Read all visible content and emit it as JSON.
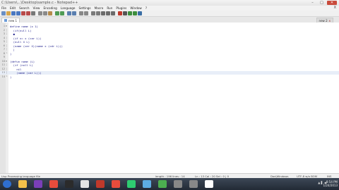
{
  "window": {
    "title": "C:\\Users\\...\\Desktop\\sample.c - Notepad++",
    "controls": {
      "minimize": "–",
      "maximize": "□",
      "close": "✕"
    }
  },
  "menu": {
    "items": [
      "File",
      "Edit",
      "Search",
      "View",
      "Encoding",
      "Language",
      "Settings",
      "Macro",
      "Run",
      "Plugins",
      "Window",
      "?"
    ],
    "close": "X"
  },
  "toolbar": {
    "icons": [
      "new-icon",
      "open-icon",
      "save-icon",
      "save-all-icon",
      "close-icon",
      "close-all-icon",
      "print-icon",
      "cut-icon",
      "copy-icon",
      "paste-icon",
      "undo-icon",
      "redo-icon",
      "find-icon",
      "replace-icon",
      "zoom-in-icon",
      "zoom-out-icon",
      "sync-v-icon",
      "sync-h-icon",
      "wrap-icon",
      "all-chars-icon",
      "indent-guide-icon",
      "macro-record-icon",
      "macro-stop-icon",
      "macro-play-icon",
      "macro-run-icon",
      "macro-save-icon"
    ],
    "colors": [
      "#6a8fc4",
      "#d7a64a",
      "#4a78c1",
      "#4a78c1",
      "#b84a4a",
      "#b84a4a",
      "#777777",
      "#8a8a8a",
      "#8a8a8a",
      "#b58a4a",
      "#4f9b54",
      "#4f9b54",
      "#5a7fb0",
      "#5a7fb0",
      "#888888",
      "#888888",
      "#7a7a7a",
      "#7a7a7a",
      "#6b6b6b",
      "#6b6b6b",
      "#6b6b6b",
      "#c0392b",
      "#555555",
      "#3d8e3d",
      "#3d8e3d",
      "#3a6ea5"
    ]
  },
  "tabs": [
    {
      "label": "new 1",
      "active": true
    },
    {
      "label": "new 2",
      "active": false
    }
  ],
  "editor": {
    "lines": [
      {
        "n": "1",
        "fold": "⊟",
        "code": "define name (x 1)"
      },
      {
        "n": "2",
        "fold": "│",
        "code": "  (if(null L)"
      },
      {
        "n": "3",
        "fold": "│",
        "code": "  ●"
      },
      {
        "n": "4",
        "fold": "│",
        "code": "  (if x= x (car L))"
      },
      {
        "n": "5",
        "fold": "│",
        "code": "  (null X L)"
      },
      {
        "n": "6",
        "fold": "│",
        "code": "  (name (cer X)(name x (cdr L)))"
      },
      {
        "n": "7",
        "fold": "│",
        "code": "  |"
      },
      {
        "n": "8",
        "fold": "└",
        "code": ")"
      },
      {
        "n": "9",
        "fold": "",
        "code": ""
      },
      {
        "n": "10",
        "fold": "⊟",
        "code": "(defun name (L)"
      },
      {
        "n": "11",
        "fold": "│",
        "code": "  (if (null L)"
      },
      {
        "n": "12",
        "fold": "│",
        "code": "    nil"
      },
      {
        "n": "13",
        "fold": "│",
        "code": "    (name (car L)))"
      },
      {
        "n": "14",
        "fold": "└",
        "code": ")"
      }
    ],
    "current_line": 13,
    "colors": {
      "code": "#1a1a8a",
      "current_line_bg": "#e8eef8"
    }
  },
  "status": {
    "language": "Lisp Processing language file",
    "length": "length : 196   lines : 14",
    "position": "Ln : 13   Col : 20   Sel : 0 | 0",
    "eol": "Dos\\Windows",
    "encoding": "UTF-8 w/o BOM",
    "mode": "INS"
  },
  "taskbar": {
    "apps": [
      "start-icon",
      "explorer-icon",
      "media-icon",
      "chrome-icon",
      "app-icon",
      "paint-icon",
      "app-icon",
      "chrome-icon",
      "app-icon",
      "app-icon",
      "c-icon",
      "app-icon",
      "app-icon",
      "c-icon"
    ],
    "colors": [
      "#2f6fd0",
      "#f2c04a",
      "#7a3fb8",
      "#e74c3c",
      "#2b2b2b",
      "#e4e4e4",
      "#c0392b",
      "#e74c3c",
      "#2ecc71",
      "#5dade2",
      "#4caf50",
      "#888888",
      "#888888",
      "#ffffff"
    ],
    "tray": "▲ ▌ ◀",
    "time": "8:54 PM",
    "date": "1/24/2013"
  }
}
